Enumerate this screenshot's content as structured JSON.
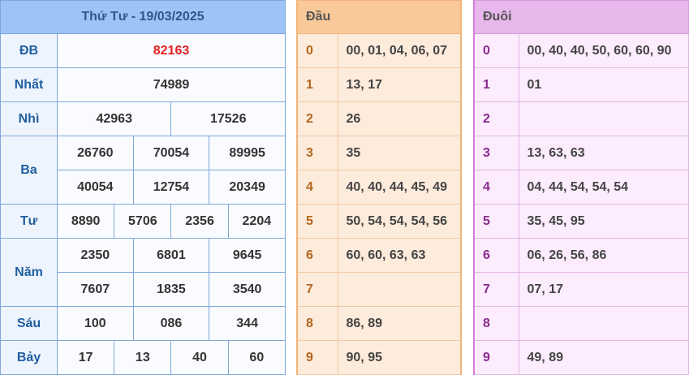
{
  "results": {
    "title": "Thứ Tư - 19/03/2025",
    "prizes": [
      {
        "label": "ĐB",
        "values": [
          "82163"
        ]
      },
      {
        "label": "Nhất",
        "values": [
          "74989"
        ]
      },
      {
        "label": "Nhì",
        "values": [
          "42963",
          "17526"
        ]
      },
      {
        "label": "Ba",
        "values": [
          "26760",
          "70054",
          "89995",
          "40054",
          "12754",
          "20349"
        ]
      },
      {
        "label": "Tư",
        "values": [
          "8890",
          "5706",
          "2356",
          "2204"
        ]
      },
      {
        "label": "Năm",
        "values": [
          "2350",
          "6801",
          "9645",
          "7607",
          "1835",
          "3540"
        ]
      },
      {
        "label": "Sáu",
        "values": [
          "100",
          "086",
          "344"
        ]
      },
      {
        "label": "Bảy",
        "values": [
          "17",
          "13",
          "40",
          "60"
        ]
      }
    ]
  },
  "head_table": {
    "header": "Đầu",
    "rows": [
      {
        "digit": "0",
        "values": "00, 01, 04, 06, 07"
      },
      {
        "digit": "1",
        "values": "13, 17"
      },
      {
        "digit": "2",
        "values": "26"
      },
      {
        "digit": "3",
        "values": "35"
      },
      {
        "digit": "4",
        "values": "40, 40, 44, 45, 49"
      },
      {
        "digit": "5",
        "values": "50, 54, 54, 54, 56"
      },
      {
        "digit": "6",
        "values": "60, 60, 63, 63"
      },
      {
        "digit": "7",
        "values": ""
      },
      {
        "digit": "8",
        "values": "86, 89"
      },
      {
        "digit": "9",
        "values": "90, 95"
      }
    ]
  },
  "tail_table": {
    "header": "Đuôi",
    "rows": [
      {
        "digit": "0",
        "values": "00, 40, 40, 50, 60, 60, 90"
      },
      {
        "digit": "1",
        "values": "01"
      },
      {
        "digit": "2",
        "values": ""
      },
      {
        "digit": "3",
        "values": "13, 63, 63"
      },
      {
        "digit": "4",
        "values": "04, 44, 54, 54, 54"
      },
      {
        "digit": "5",
        "values": "35, 45, 95"
      },
      {
        "digit": "6",
        "values": "06, 26, 56, 86"
      },
      {
        "digit": "7",
        "values": "07, 17"
      },
      {
        "digit": "8",
        "values": ""
      },
      {
        "digit": "9",
        "values": "49, 89"
      }
    ]
  }
}
